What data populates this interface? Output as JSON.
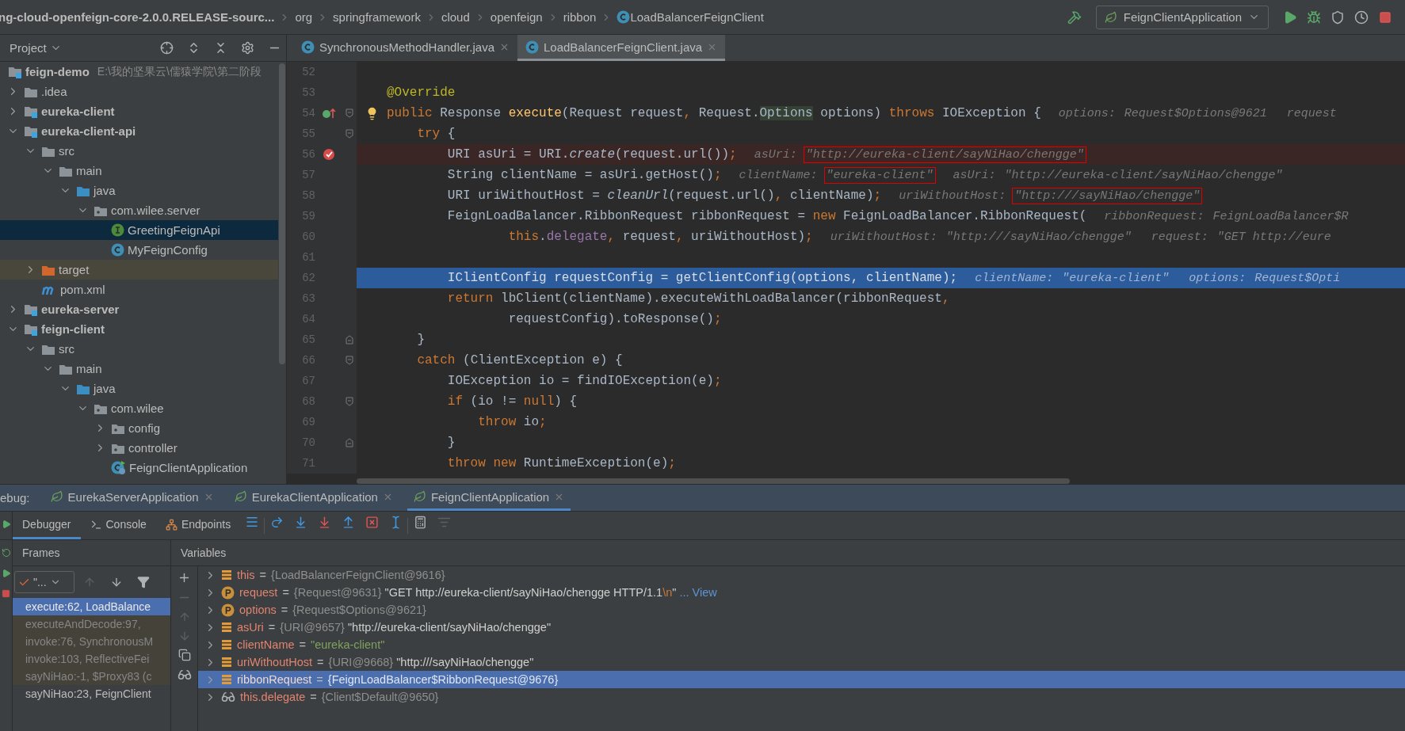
{
  "navbar": {
    "breadcrumbs": [
      {
        "label": "ng-cloud-openfeign-core-2.0.0.RELEASE-sourc...",
        "kind": "archive"
      },
      {
        "label": "org",
        "kind": "package"
      },
      {
        "label": "springframework",
        "kind": "package"
      },
      {
        "label": "cloud",
        "kind": "package"
      },
      {
        "label": "openfeign",
        "kind": "package"
      },
      {
        "label": "ribbon",
        "kind": "package"
      },
      {
        "label": "LoadBalancerFeignClient",
        "kind": "class"
      }
    ],
    "run_config": "FeignClientApplication"
  },
  "project": {
    "title": "Project",
    "tree": [
      {
        "label": "feign-demo",
        "path": "E:\\我的坚果云\\儒猿学院\\第二阶段",
        "kind": "module",
        "selected": false,
        "children": [
          {
            "label": ".idea",
            "kind": "folder",
            "expanded": false,
            "selected": false
          },
          {
            "label": "eureka-client",
            "kind": "module",
            "expanded": false,
            "selected": false
          },
          {
            "label": "eureka-client-api",
            "kind": "module",
            "expanded": true,
            "selected": false,
            "children": [
              {
                "label": "src",
                "kind": "folder",
                "expanded": true,
                "selected": false,
                "children": [
                  {
                    "label": "main",
                    "kind": "folder",
                    "expanded": true,
                    "selected": false,
                    "children": [
                      {
                        "label": "java",
                        "kind": "source",
                        "expanded": true,
                        "selected": false,
                        "children": [
                          {
                            "label": "com.wilee.server",
                            "kind": "package",
                            "expanded": true,
                            "selected": false,
                            "children": [
                              {
                                "label": "GreetingFeignApi",
                                "kind": "interface",
                                "selected": true
                              },
                              {
                                "label": "MyFeignConfig",
                                "kind": "class",
                                "selected": false
                              }
                            ]
                          }
                        ]
                      }
                    ]
                  }
                ]
              },
              {
                "label": "target",
                "kind": "excluded",
                "expanded": false,
                "selected": false
              },
              {
                "label": "pom.xml",
                "kind": "maven",
                "selected": false
              }
            ]
          },
          {
            "label": "eureka-server",
            "kind": "module",
            "expanded": false,
            "selected": false
          },
          {
            "label": "feign-client",
            "kind": "module",
            "expanded": true,
            "selected": false,
            "children": [
              {
                "label": "src",
                "kind": "folder",
                "expanded": true,
                "selected": false,
                "children": [
                  {
                    "label": "main",
                    "kind": "folder",
                    "expanded": true,
                    "selected": false,
                    "children": [
                      {
                        "label": "java",
                        "kind": "source",
                        "expanded": true,
                        "selected": false,
                        "children": [
                          {
                            "label": "com.wilee",
                            "kind": "package",
                            "expanded": true,
                            "selected": false,
                            "children": [
                              {
                                "label": "config",
                                "kind": "package",
                                "expanded": false,
                                "selected": false
                              },
                              {
                                "label": "controller",
                                "kind": "package",
                                "expanded": false,
                                "selected": false
                              },
                              {
                                "label": "FeignClientApplication",
                                "kind": "spring",
                                "selected": false
                              }
                            ]
                          }
                        ]
                      }
                    ]
                  }
                ]
              }
            ]
          }
        ]
      }
    ]
  },
  "editor": {
    "tabs": [
      {
        "label": "SynchronousMethodHandler.java",
        "selected": false
      },
      {
        "label": "LoadBalancerFeignClient.java",
        "selected": true
      }
    ],
    "lines": [
      {
        "number": "52",
        "kind": "normal"
      },
      {
        "number": "53",
        "kind": "normal",
        "tokens": [
          {
            "text": "@Override",
            "kind": "annotation"
          }
        ]
      },
      {
        "number": "54",
        "kind": "normal",
        "override_marker": true,
        "intention": true,
        "fold_open": true,
        "tokens": [
          {
            "text": "public",
            "kind": "keyword"
          },
          {
            "text": " Response ",
            "kind": "plain"
          },
          {
            "text": "execute",
            "kind": "method"
          },
          {
            "text": "(Request request",
            "kind": "plain"
          },
          {
            "text": ",",
            "kind": "keyword"
          },
          {
            "text": " Request.",
            "kind": "plain"
          },
          {
            "text": "Options",
            "kind": "highlight"
          },
          {
            "text": " options) ",
            "kind": "plain"
          },
          {
            "text": "throws",
            "kind": "keyword"
          },
          {
            "text": " IOException {",
            "kind": "plain"
          }
        ],
        "hints": [
          {
            "label": "options:",
            "value": "Request$Options@9621"
          },
          {
            "label": "request"
          }
        ]
      },
      {
        "number": "55",
        "kind": "normal",
        "fold_open": true,
        "tokens": [
          {
            "text": "    try",
            "kind": "keyword"
          },
          {
            "text": " {",
            "kind": "plain"
          }
        ]
      },
      {
        "number": "56",
        "kind": "breakpoint",
        "tokens": [
          {
            "text": "        URI asUri = URI.",
            "kind": "plain"
          },
          {
            "text": "create",
            "kind": "italic"
          },
          {
            "text": "(request.url())",
            "kind": "plain"
          },
          {
            "text": ";",
            "kind": "keyword"
          }
        ],
        "hints": [
          {
            "label": "asUri:",
            "value": "\"http://eureka-client/sayNiHao/chengge\"",
            "boxed": true
          }
        ]
      },
      {
        "number": "57",
        "kind": "normal",
        "tokens": [
          {
            "text": "        String clientName = asUri.getHost()",
            "kind": "plain"
          },
          {
            "text": ";",
            "kind": "keyword"
          }
        ],
        "hints": [
          {
            "label": "clientName:",
            "value": "\"eureka-client\"",
            "boxed": true
          },
          {
            "label": "asUri:",
            "value": "\"http://eureka-client/sayNiHao/chengge\""
          }
        ]
      },
      {
        "number": "58",
        "kind": "normal",
        "tokens": [
          {
            "text": "        URI uriWithoutHost = ",
            "kind": "plain"
          },
          {
            "text": "cleanUrl",
            "kind": "italic"
          },
          {
            "text": "(request.url()",
            "kind": "plain"
          },
          {
            "text": ",",
            "kind": "keyword"
          },
          {
            "text": " clientName)",
            "kind": "plain"
          },
          {
            "text": ";",
            "kind": "keyword"
          }
        ],
        "hints": [
          {
            "label": "uriWithoutHost:",
            "value": "\"http:///sayNiHao/chengge\"",
            "boxed": true
          }
        ]
      },
      {
        "number": "59",
        "kind": "normal",
        "tokens": [
          {
            "text": "        FeignLoadBalancer.RibbonRequest ribbonRequest = ",
            "kind": "plain"
          },
          {
            "text": "new",
            "kind": "keyword"
          },
          {
            "text": " FeignLoadBalancer.RibbonRequest(",
            "kind": "plain"
          }
        ],
        "hints": [
          {
            "label": "ribbonRequest:",
            "value": "FeignLoadBalancer$R"
          }
        ]
      },
      {
        "number": "60",
        "kind": "normal",
        "tokens": [
          {
            "text": "                this",
            "kind": "keyword"
          },
          {
            "text": ".",
            "kind": "plain"
          },
          {
            "text": "delegate",
            "kind": "field"
          },
          {
            "text": ",",
            "kind": "keyword"
          },
          {
            "text": " request",
            "kind": "plain"
          },
          {
            "text": ",",
            "kind": "keyword"
          },
          {
            "text": " uriWithoutHost)",
            "kind": "plain"
          },
          {
            "text": ";",
            "kind": "keyword"
          }
        ],
        "hints": [
          {
            "label": "uriWithoutHost:",
            "value": "\"http:///sayNiHao/chengge\""
          },
          {
            "label": "request:",
            "value": "\"GET http://eure"
          }
        ]
      },
      {
        "number": "61",
        "kind": "normal"
      },
      {
        "number": "62",
        "kind": "execution",
        "tokens": [
          {
            "text": "        IClientConfig requestConfig = getClientConfig(options",
            "kind": "plain"
          },
          {
            "text": ",",
            "kind": "keyword"
          },
          {
            "text": " clientName)",
            "kind": "plain"
          },
          {
            "text": ";",
            "kind": "keyword"
          }
        ],
        "hints": [
          {
            "label": "clientName:",
            "value": "\"eureka-client\""
          },
          {
            "label": "options:",
            "value": "Request$Opti"
          }
        ]
      },
      {
        "number": "63",
        "kind": "normal",
        "tokens": [
          {
            "text": "        return",
            "kind": "keyword"
          },
          {
            "text": " lbClient(clientName).executeWithLoadBalancer(ribbonRequest",
            "kind": "plain"
          },
          {
            "text": ",",
            "kind": "keyword"
          }
        ]
      },
      {
        "number": "64",
        "kind": "normal",
        "tokens": [
          {
            "text": "                requestConfig).toResponse()",
            "kind": "plain"
          },
          {
            "text": ";",
            "kind": "keyword"
          }
        ]
      },
      {
        "number": "65",
        "kind": "normal",
        "fold_close": true,
        "tokens": [
          {
            "text": "    }",
            "kind": "plain"
          }
        ]
      },
      {
        "number": "66",
        "kind": "normal",
        "fold_open": true,
        "tokens": [
          {
            "text": "    catch",
            "kind": "keyword"
          },
          {
            "text": " (ClientException e) {",
            "kind": "plain"
          }
        ]
      },
      {
        "number": "67",
        "kind": "normal",
        "tokens": [
          {
            "text": "        IOException io = findIOException(e)",
            "kind": "plain"
          },
          {
            "text": ";",
            "kind": "keyword"
          }
        ]
      },
      {
        "number": "68",
        "kind": "normal",
        "fold_open": true,
        "tokens": [
          {
            "text": "        if",
            "kind": "keyword"
          },
          {
            "text": " (io != ",
            "kind": "plain"
          },
          {
            "text": "null",
            "kind": "keyword"
          },
          {
            "text": ") {",
            "kind": "plain"
          }
        ]
      },
      {
        "number": "69",
        "kind": "normal",
        "tokens": [
          {
            "text": "            throw",
            "kind": "keyword"
          },
          {
            "text": " io",
            "kind": "plain"
          },
          {
            "text": ";",
            "kind": "keyword"
          }
        ]
      },
      {
        "number": "70",
        "kind": "normal",
        "fold_close": true,
        "tokens": [
          {
            "text": "        }",
            "kind": "plain"
          }
        ]
      },
      {
        "number": "71",
        "kind": "normal",
        "tokens": [
          {
            "text": "        throw",
            "kind": "keyword"
          },
          {
            "text": " new",
            "kind": "keyword"
          },
          {
            "text": " RuntimeException(e)",
            "kind": "plain"
          },
          {
            "text": ";",
            "kind": "keyword"
          }
        ]
      }
    ]
  },
  "debug": {
    "label": "ebug:",
    "sessions": [
      {
        "label": "EurekaServerApplication",
        "selected": false
      },
      {
        "label": "EurekaClientApplication",
        "selected": false
      },
      {
        "label": "FeignClientApplication",
        "selected": true
      }
    ],
    "tabs": [
      {
        "label": "Debugger",
        "kind": "debugger",
        "selected": true
      },
      {
        "label": "Console",
        "kind": "console",
        "selected": false
      },
      {
        "label": "Endpoints",
        "kind": "endpoints",
        "selected": false
      }
    ],
    "frames": {
      "title": "Frames",
      "thread": "\"...",
      "items": [
        {
          "label": "execute:62, LoadBalance",
          "kind": "project",
          "selected": true
        },
        {
          "label": "executeAndDecode:97, ",
          "kind": "library",
          "selected": false
        },
        {
          "label": "invoke:76, SynchronousM",
          "kind": "library",
          "selected": false
        },
        {
          "label": "invoke:103, ReflectiveFei",
          "kind": "library",
          "selected": false
        },
        {
          "label": "sayNiHao:-1, $Proxy83 (c",
          "kind": "library",
          "selected": false
        },
        {
          "label": "sayNiHao:23, FeignClient",
          "kind": "project",
          "selected": false
        }
      ]
    },
    "variables": {
      "title": "Variables",
      "items": [
        {
          "name": "this",
          "kind": "field",
          "selected": false,
          "equals": "=",
          "parts": [
            {
              "text": "{LoadBalancerFeignClient@9616}",
              "kind": "ref"
            }
          ]
        },
        {
          "name": "request",
          "kind": "parameter",
          "selected": false,
          "equals": "=",
          "parts": [
            {
              "text": "{Request@9631}",
              "kind": "ref"
            },
            {
              "text": "\"GET http://eureka-client/sayNiHao/chengge HTTP/1.1",
              "kind": "text"
            },
            {
              "text": "\\n",
              "kind": "escape"
            },
            {
              "text": "\"",
              "kind": "text"
            },
            {
              "text": "... View",
              "kind": "link"
            }
          ]
        },
        {
          "name": "options",
          "kind": "parameter",
          "selected": false,
          "equals": "=",
          "parts": [
            {
              "text": "{Request$Options@9621}",
              "kind": "ref"
            }
          ]
        },
        {
          "name": "asUri",
          "kind": "field",
          "selected": false,
          "equals": "=",
          "parts": [
            {
              "text": "{URI@9657}",
              "kind": "ref"
            },
            {
              "text": "\"http://eureka-client/sayNiHao/chengge\"",
              "kind": "text"
            }
          ]
        },
        {
          "name": "clientName",
          "kind": "field",
          "selected": false,
          "equals": "=",
          "parts": [
            {
              "text": "\"eureka-client\"",
              "kind": "string"
            }
          ]
        },
        {
          "name": "uriWithoutHost",
          "kind": "field",
          "selected": false,
          "equals": "=",
          "parts": [
            {
              "text": "{URI@9668}",
              "kind": "ref"
            },
            {
              "text": "\"http:///sayNiHao/chengge\"",
              "kind": "text"
            }
          ]
        },
        {
          "name": "ribbonRequest",
          "kind": "field",
          "selected": true,
          "equals": "=",
          "parts": [
            {
              "text": "{FeignLoadBalancer$RibbonRequest@9676}",
              "kind": "ref"
            }
          ]
        },
        {
          "name": "this.delegate",
          "kind": "watch",
          "selected": false,
          "equals": "=",
          "parts": [
            {
              "text": "{Client$Default@9650}",
              "kind": "ref"
            }
          ]
        }
      ]
    }
  }
}
